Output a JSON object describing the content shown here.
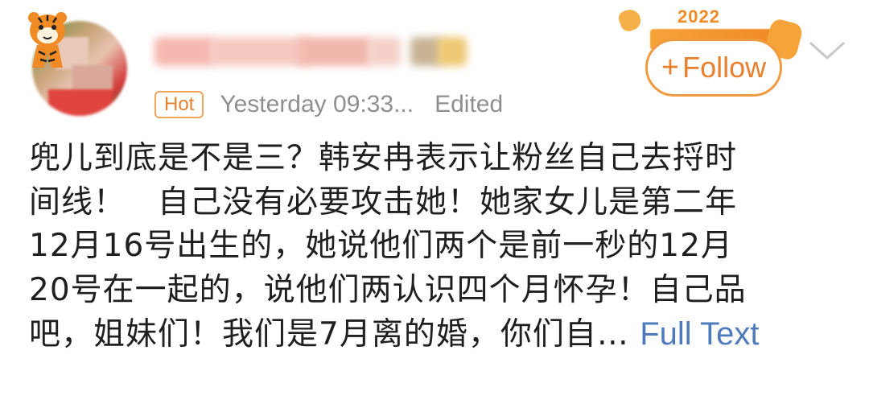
{
  "author": {
    "badge": "Hot",
    "time": "Yesterday 09:33...",
    "edited": "Edited"
  },
  "event_badge": {
    "year": "2022",
    "colors": {
      "accent": "#f08a25"
    }
  },
  "follow": {
    "plus": "+",
    "label": "Follow"
  },
  "post": {
    "lines": [
      "兜儿到底是不是三？韩安冉表示让粉丝自己去捋时",
      "间线！　自己没有必要攻击她！她家女儿是第二年",
      "12月16号出生的，她说他们两个是前一秒的12月",
      "20号在一起的，说他们两认识四个月怀孕！自己品",
      "吧，姐妹们！我们是7月离的婚，你们自…"
    ],
    "full_text_link": "Full Text"
  },
  "icons": {
    "avatar_decoration": "tiger-icon",
    "menu": "chevron-down-icon"
  }
}
